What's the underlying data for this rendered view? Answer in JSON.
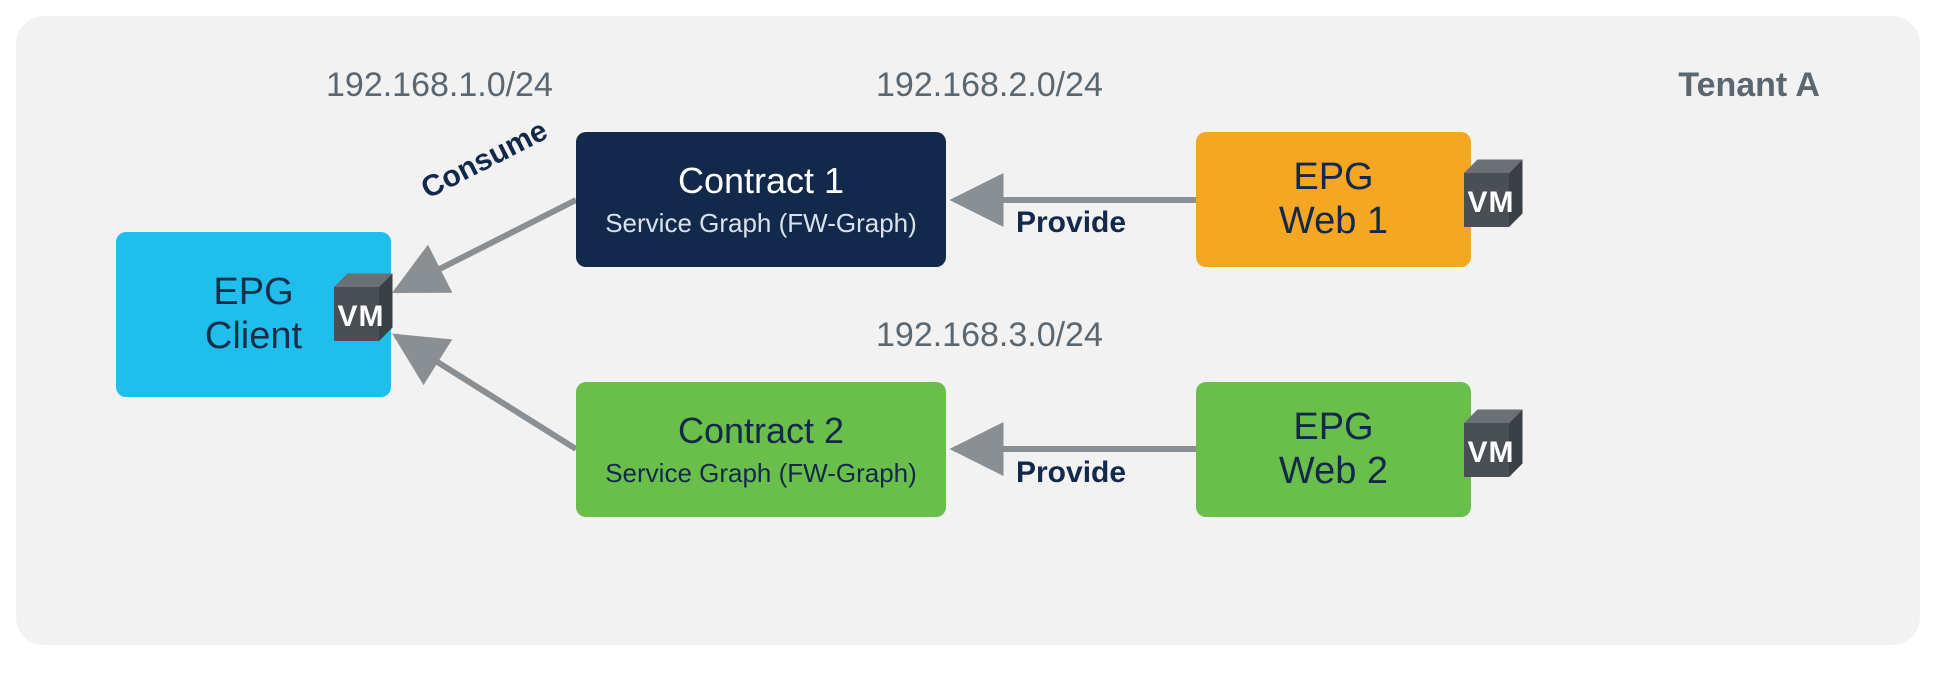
{
  "tenant_label": "Tenant A",
  "subnets": {
    "client": "192.168.1.0/24",
    "web1": "192.168.2.0/24",
    "web2": "192.168.3.0/24"
  },
  "nodes": {
    "epg_client": {
      "line1": "EPG",
      "line2": "Client"
    },
    "contract1": {
      "title": "Contract 1",
      "sub": "Service Graph (FW-Graph)"
    },
    "contract2": {
      "title": "Contract 2",
      "sub": "Service Graph (FW-Graph)"
    },
    "epg_web1": {
      "line1": "EPG",
      "line2": "Web 1"
    },
    "epg_web2": {
      "line1": "EPG",
      "line2": "Web 2"
    }
  },
  "edges": {
    "consume": "Consume",
    "provide": "Provide"
  },
  "vm_label": "VM"
}
